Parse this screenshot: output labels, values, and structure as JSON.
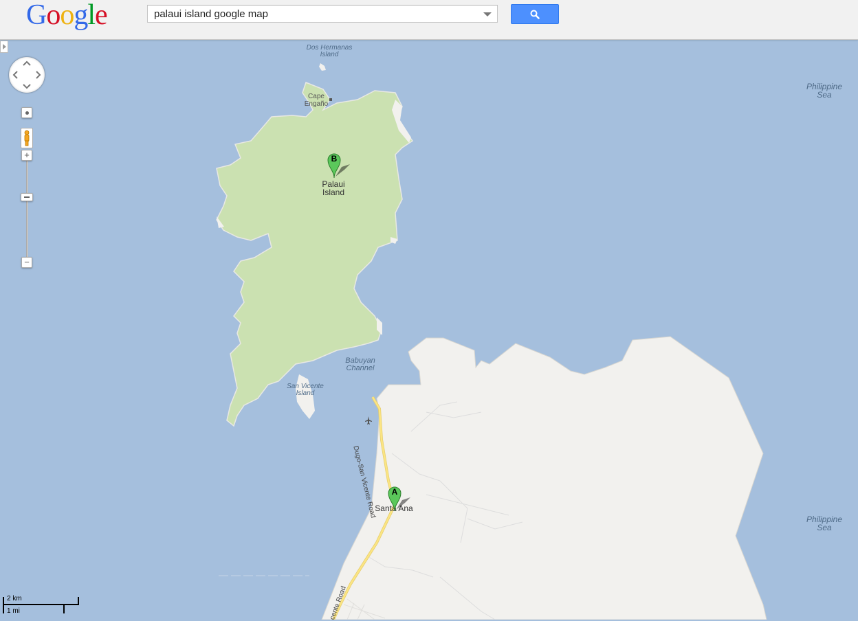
{
  "header": {
    "logo_letters": [
      {
        "char": "G",
        "color": "#3369e8"
      },
      {
        "char": "o",
        "color": "#d50f25"
      },
      {
        "char": "o",
        "color": "#eeb211"
      },
      {
        "char": "g",
        "color": "#3369e8"
      },
      {
        "char": "l",
        "color": "#009925"
      },
      {
        "char": "e",
        "color": "#d50f25"
      }
    ],
    "search_value": "palaui island google map",
    "search_button_icon": "magnifier-icon"
  },
  "map": {
    "water_color": "#a5bfdd",
    "land_color": "#f2f1ee",
    "park_color": "#cbe1b1",
    "road_color": "#fbe584",
    "labels": {
      "dos_hermanas": [
        "Dos Hermanas",
        "Island"
      ],
      "cape_engano": [
        "Cape",
        "Engaño"
      ],
      "palaui_island": [
        "Palaui",
        "Island"
      ],
      "babuyan_channel": [
        "Babuyan",
        "Channel"
      ],
      "san_vicente": [
        "San Vicente",
        "Island"
      ],
      "philippine_sea_top": [
        "Philippine",
        "Sea"
      ],
      "philippine_sea_bottom": [
        "Philippine",
        "Sea"
      ],
      "santa_ana": "Santa Ana",
      "road_name": "Dugo-San Vicente Road",
      "road_name_bottom": "cente Road"
    },
    "markers": [
      {
        "letter": "B",
        "place": "Palaui Island"
      },
      {
        "letter": "A",
        "place": "Santa Ana"
      }
    ],
    "scale": {
      "metric": "2 km",
      "imperial": "1 mi"
    }
  },
  "controls": {
    "pan_icon": "pan-arrows-icon",
    "zoom_in_symbol": "+",
    "zoom_out_symbol": "−"
  }
}
